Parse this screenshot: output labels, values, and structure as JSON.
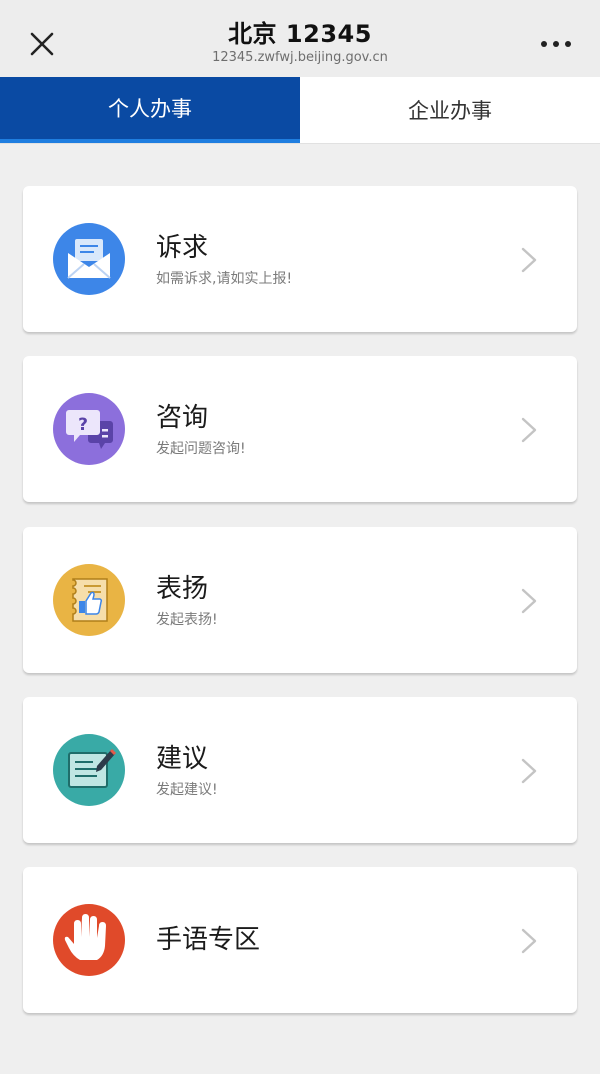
{
  "header": {
    "title": "北京 12345",
    "url": "12345.zwfwj.beijing.gov.cn",
    "close_icon": "close-icon",
    "more_icon": "more-dots-icon"
  },
  "tabs": [
    {
      "label": "个人办事",
      "active": true
    },
    {
      "label": "企业办事",
      "active": false
    }
  ],
  "services": [
    {
      "name": "诉求",
      "desc": "如需诉求,请如实上报!",
      "icon": "envelope-icon",
      "color": "#3d86e8"
    },
    {
      "name": "咨询",
      "desc": "发起问题咨询!",
      "icon": "chat-question-icon",
      "color": "#8c6fdc"
    },
    {
      "name": "表扬",
      "desc": "发起表扬!",
      "icon": "thumbs-up-icon",
      "color": "#e9b444"
    },
    {
      "name": "建议",
      "desc": "发起建议!",
      "icon": "edit-note-icon",
      "color": "#39aaa6"
    },
    {
      "name": "手语专区",
      "desc": "",
      "icon": "hand-icon",
      "color": "#e04a2a"
    }
  ],
  "colors": {
    "tab_active_bg": "#0a4aa3",
    "tab_active_underline": "#1f7ee0",
    "page_bg": "#efefef"
  }
}
